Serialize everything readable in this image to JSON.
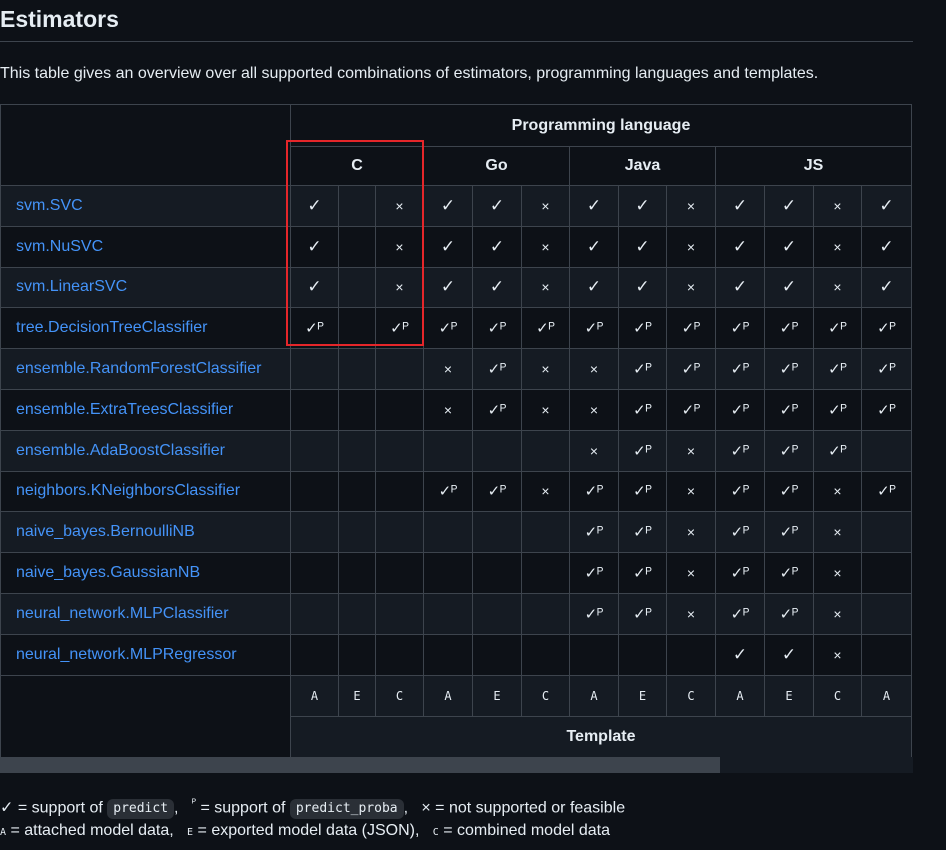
{
  "heading": "Estimators",
  "intro": "This table gives an overview over all supported combinations of estimators, programming languages and templates.",
  "table": {
    "programming_language_label": "Programming language",
    "template_label": "Template",
    "languages": [
      "C",
      "Go",
      "Java",
      "JS"
    ],
    "template_codes": [
      "A",
      "E",
      "C",
      "A",
      "E",
      "C",
      "A",
      "E",
      "C",
      "A",
      "E",
      "C",
      "A"
    ],
    "rows": [
      {
        "name": "svm.SVC",
        "cells": [
          "✓",
          "",
          "×",
          "✓",
          "✓",
          "×",
          "✓",
          "✓",
          "×",
          "✓",
          "✓",
          "×",
          "✓"
        ]
      },
      {
        "name": "svm.NuSVC",
        "cells": [
          "✓",
          "",
          "×",
          "✓",
          "✓",
          "×",
          "✓",
          "✓",
          "×",
          "✓",
          "✓",
          "×",
          "✓"
        ]
      },
      {
        "name": "svm.LinearSVC",
        "cells": [
          "✓",
          "",
          "×",
          "✓",
          "✓",
          "×",
          "✓",
          "✓",
          "×",
          "✓",
          "✓",
          "×",
          "✓"
        ]
      },
      {
        "name": "tree.DecisionTreeClassifier",
        "cells": [
          "✓ᴾ",
          "",
          "✓ᴾ",
          "✓ᴾ",
          "✓ᴾ",
          "✓ᴾ",
          "✓ᴾ",
          "✓ᴾ",
          "✓ᴾ",
          "✓ᴾ",
          "✓ᴾ",
          "✓ᴾ",
          "✓ᴾ"
        ]
      },
      {
        "name": "ensemble.RandomForestClassifier",
        "cells": [
          "",
          "",
          "",
          "×",
          "✓ᴾ",
          "×",
          "×",
          "✓ᴾ",
          "✓ᴾ",
          "✓ᴾ",
          "✓ᴾ",
          "✓ᴾ",
          "✓ᴾ"
        ]
      },
      {
        "name": "ensemble.ExtraTreesClassifier",
        "cells": [
          "",
          "",
          "",
          "×",
          "✓ᴾ",
          "×",
          "×",
          "✓ᴾ",
          "✓ᴾ",
          "✓ᴾ",
          "✓ᴾ",
          "✓ᴾ",
          "✓ᴾ"
        ]
      },
      {
        "name": "ensemble.AdaBoostClassifier",
        "cells": [
          "",
          "",
          "",
          "",
          "",
          "",
          "×",
          "✓ᴾ",
          "×",
          "✓ᴾ",
          "✓ᴾ",
          "✓ᴾ",
          ""
        ]
      },
      {
        "name": "neighbors.KNeighborsClassifier",
        "cells": [
          "",
          "",
          "",
          "✓ᴾ",
          "✓ᴾ",
          "×",
          "✓ᴾ",
          "✓ᴾ",
          "×",
          "✓ᴾ",
          "✓ᴾ",
          "×",
          "✓ᴾ"
        ]
      },
      {
        "name": "naive_bayes.BernoulliNB",
        "cells": [
          "",
          "",
          "",
          "",
          "",
          "",
          "✓ᴾ",
          "✓ᴾ",
          "×",
          "✓ᴾ",
          "✓ᴾ",
          "×",
          ""
        ]
      },
      {
        "name": "naive_bayes.GaussianNB",
        "cells": [
          "",
          "",
          "",
          "",
          "",
          "",
          "✓ᴾ",
          "✓ᴾ",
          "×",
          "✓ᴾ",
          "✓ᴾ",
          "×",
          ""
        ]
      },
      {
        "name": "neural_network.MLPClassifier",
        "cells": [
          "",
          "",
          "",
          "",
          "",
          "",
          "✓ᴾ",
          "✓ᴾ",
          "×",
          "✓ᴾ",
          "✓ᴾ",
          "×",
          ""
        ]
      },
      {
        "name": "neural_network.MLPRegressor",
        "cells": [
          "",
          "",
          "",
          "",
          "",
          "",
          "",
          "",
          "",
          "✓",
          "✓",
          "×",
          ""
        ]
      }
    ]
  },
  "legend": {
    "check_sym": "✓",
    "check_text": " = support of ",
    "predict_code": "predict",
    "p_sym": "ᴾ",
    "p_text": " = support of ",
    "predict_proba_code": "predict_proba",
    "cross_sym": "×",
    "cross_text": " = not supported or feasible",
    "a_sym": "A",
    "a_text": " = attached model data,",
    "e_sym": "E",
    "e_text": " = exported model data (JSON),",
    "c_sym": "C",
    "c_text": " = combined model data"
  },
  "colors": {
    "background": "#0d1117",
    "alt_row": "#151b23",
    "border": "#3d444d",
    "link": "#4493f8",
    "highlight_box": "#e5262a"
  }
}
